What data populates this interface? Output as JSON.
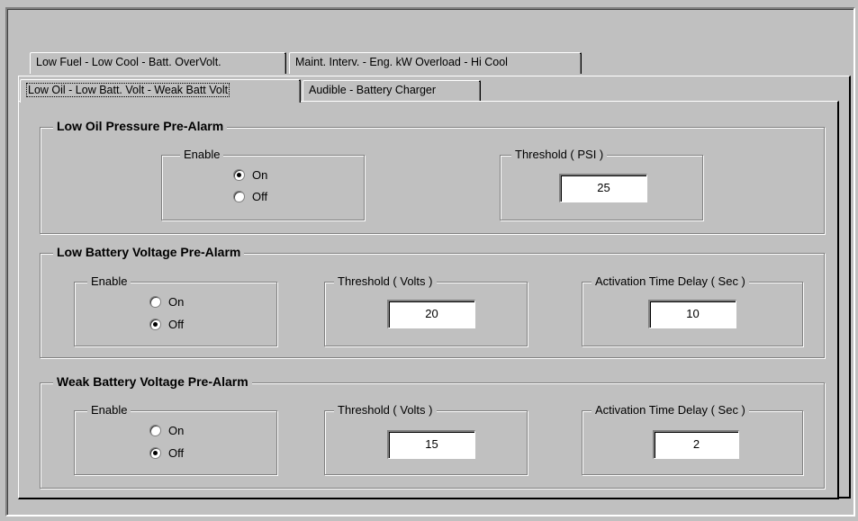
{
  "tabs": {
    "row1": [
      "Low Fuel - Low Cool - Batt. OverVolt.",
      "Maint. Interv. - Eng. kW Overload - Hi Cool"
    ],
    "row2": [
      "Low Oil - Low Batt. Volt - Weak Batt Volt",
      "Audible - Battery Charger"
    ]
  },
  "oil": {
    "title": "Low Oil Pressure Pre-Alarm",
    "enable": {
      "label": "Enable",
      "on": "On",
      "off": "Off",
      "selected": "On"
    },
    "threshold": {
      "label": "Threshold ( PSI )",
      "value": "25"
    }
  },
  "lowbatt": {
    "title": "Low Battery Voltage Pre-Alarm",
    "enable": {
      "label": "Enable",
      "on": "On",
      "off": "Off",
      "selected": "Off"
    },
    "threshold": {
      "label": "Threshold ( Volts )",
      "value": "20"
    },
    "delay": {
      "label": "Activation Time Delay  ( Sec )",
      "value": "10"
    }
  },
  "weakbatt": {
    "title": "Weak Battery Voltage Pre-Alarm",
    "enable": {
      "label": "Enable",
      "on": "On",
      "off": "Off",
      "selected": "Off"
    },
    "threshold": {
      "label": "Threshold ( Volts )",
      "value": "15"
    },
    "delay": {
      "label": "Activation Time Delay ( Sec )",
      "value": "2"
    }
  }
}
